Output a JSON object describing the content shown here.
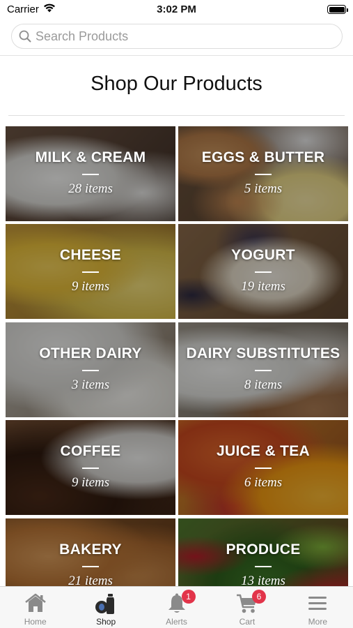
{
  "status_bar": {
    "carrier": "Carrier",
    "time": "3:02 PM",
    "icons": [
      "wifi-icon",
      "battery-icon"
    ]
  },
  "search": {
    "placeholder": "Search Products",
    "value": ""
  },
  "page_title": "Shop Our Products",
  "categories": [
    {
      "name": "MILK & CREAM",
      "count": "28 items"
    },
    {
      "name": "EGGS & BUTTER",
      "count": "5 items"
    },
    {
      "name": "CHEESE",
      "count": "9 items"
    },
    {
      "name": "YOGURT",
      "count": "19 items"
    },
    {
      "name": "OTHER DAIRY",
      "count": "3 items"
    },
    {
      "name": "DAIRY SUBSTITUTES",
      "count": "8 items"
    },
    {
      "name": "COFFEE",
      "count": "9 items"
    },
    {
      "name": "JUICE & TEA",
      "count": "6 items"
    },
    {
      "name": "BAKERY",
      "count": "21 items"
    },
    {
      "name": "PRODUCE",
      "count": "13 items"
    }
  ],
  "tab_bar": {
    "tabs": [
      {
        "label": "Home",
        "icon": "home-icon",
        "active": false
      },
      {
        "label": "Shop",
        "icon": "shop-icon",
        "active": true
      },
      {
        "label": "Alerts",
        "icon": "bell-icon",
        "active": false,
        "badge": "1"
      },
      {
        "label": "Cart",
        "icon": "cart-icon",
        "active": false,
        "badge": "6"
      },
      {
        "label": "More",
        "icon": "menu-icon",
        "active": false
      }
    ]
  },
  "colors": {
    "badge": "#e2344a",
    "active_tab": "#222222",
    "inactive_tab": "#8a8a8a",
    "tab_bar_bg": "#f7f7f7"
  }
}
